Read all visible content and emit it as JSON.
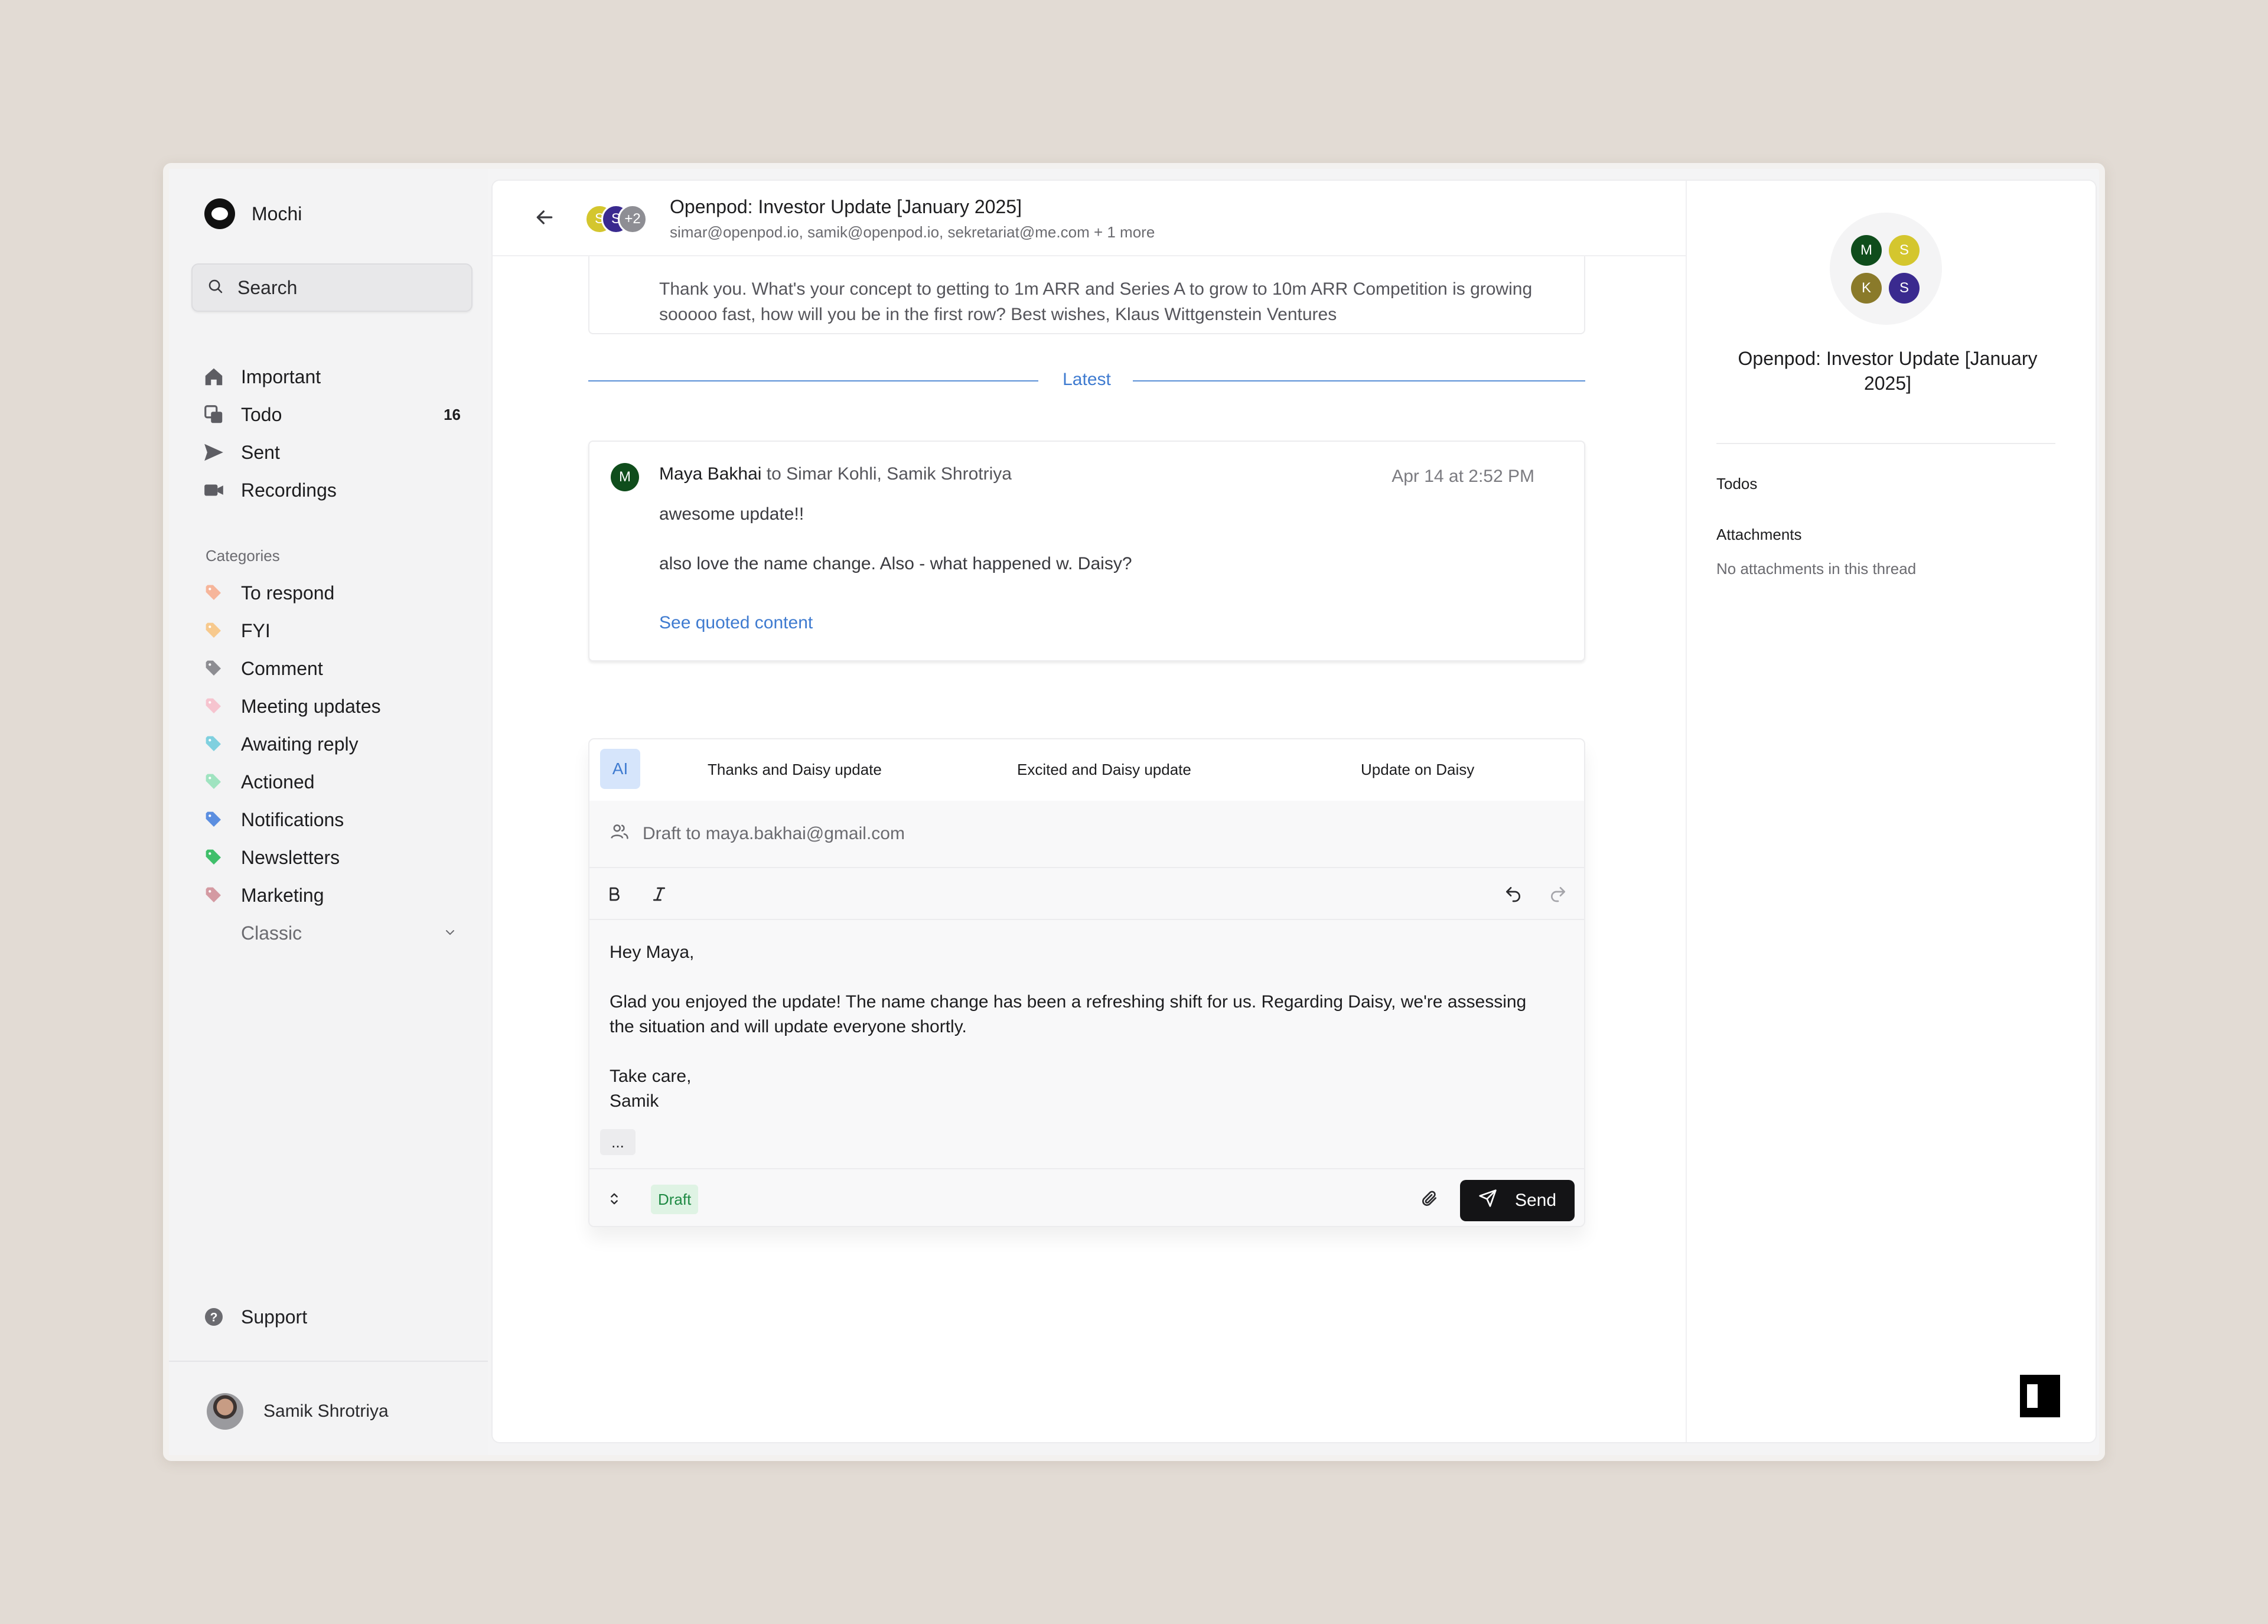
{
  "app": {
    "name": "Mochi"
  },
  "sidebar": {
    "search_label": "Search",
    "nav": [
      {
        "label": "Important",
        "icon": "home-icon"
      },
      {
        "label": "Todo",
        "icon": "todo-icon",
        "count": "16"
      },
      {
        "label": "Sent",
        "icon": "send-icon"
      },
      {
        "label": "Recordings",
        "icon": "video-icon"
      }
    ],
    "categories_header": "Categories",
    "categories": [
      {
        "label": "To respond",
        "color": "#f6b59a"
      },
      {
        "label": "FYI",
        "color": "#f7c98d"
      },
      {
        "label": "Comment",
        "color": "#8d8d92"
      },
      {
        "label": "Meeting updates",
        "color": "#f6c4cf"
      },
      {
        "label": "Awaiting reply",
        "color": "#7fd0df"
      },
      {
        "label": "Actioned",
        "color": "#9fe3c0"
      },
      {
        "label": "Notifications",
        "color": "#5b8ee0"
      },
      {
        "label": "Newsletters",
        "color": "#3fbf6a"
      },
      {
        "label": "Marketing",
        "color": "#d49aa2"
      }
    ],
    "classic_label": "Classic",
    "support_label": "Support",
    "user_name": "Samik Shrotriya"
  },
  "thread": {
    "title": "Openpod: Investor Update [January 2025]",
    "recipients": "simar@openpod.io, samik@openpod.io, sekretariat@me.com + 1 more",
    "avatars": [
      {
        "initial": "S",
        "color": "#d4c62e"
      },
      {
        "initial": "S",
        "color": "#3a2a8f"
      },
      {
        "initial": "+2",
        "color": "#8e8e94"
      }
    ],
    "previous_message": "Thank you. What's your concept to getting to 1m ARR and Series A to grow to 10m ARR Competition is growing sooooo fast, how will you be in the first row? Best wishes, Klaus Wittgenstein Ventures",
    "latest_label": "Latest",
    "message": {
      "avatar": "M",
      "sender": "Maya Bakhai",
      "to_word": "to",
      "recipients": "Simar Kohli, Samik Shrotriya",
      "date": "Apr 14 at 2:52 PM",
      "line1": "awesome update!!",
      "line2": "also love the name change.  Also - what happened w. Daisy?",
      "quoted_link": "See quoted content"
    }
  },
  "composer": {
    "ai_label": "AI",
    "suggestions": [
      "Thanks and Daisy update",
      "Excited and Daisy update",
      "Update on Daisy"
    ],
    "draft_to": "Draft to maya.bakhai@gmail.com",
    "body": {
      "greeting": "Hey Maya,",
      "para": "Glad you enjoyed the update! The name change has been a refreshing shift for us. Regarding Daisy, we're assessing the situation and will update everyone shortly.",
      "closing": "Take care,",
      "signature": "Samik"
    },
    "ellipsis": "...",
    "draft_badge": "Draft",
    "send_label": "Send"
  },
  "details": {
    "avatars": [
      {
        "initial": "M",
        "color": "#0f4d1c"
      },
      {
        "initial": "S",
        "color": "#d4c62e"
      },
      {
        "initial": "K",
        "color": "#8a7a2a"
      },
      {
        "initial": "S",
        "color": "#3a2a8f"
      }
    ],
    "title": "Openpod: Investor Update [January 2025]",
    "todos_label": "Todos",
    "attachments_label": "Attachments",
    "no_attachments": "No attachments in this thread"
  }
}
